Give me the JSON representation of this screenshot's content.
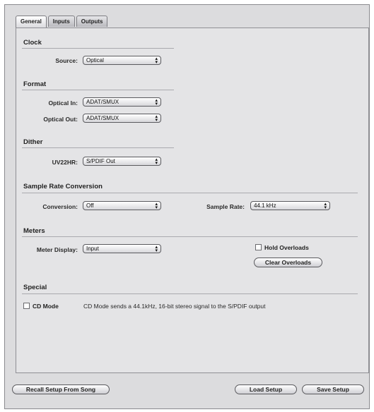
{
  "tabs": [
    {
      "label": "General"
    },
    {
      "label": "Inputs"
    },
    {
      "label": "Outputs"
    }
  ],
  "clock": {
    "heading": "Clock",
    "source": {
      "label": "Source:",
      "value": "Optical"
    }
  },
  "format": {
    "heading": "Format",
    "optical_in": {
      "label": "Optical In:",
      "value": "ADAT/SMUX"
    },
    "optical_out": {
      "label": "Optical Out:",
      "value": "ADAT/SMUX"
    }
  },
  "dither": {
    "heading": "Dither",
    "uv22hr": {
      "label": "UV22HR:",
      "value": "S/PDIF Out"
    }
  },
  "src": {
    "heading": "Sample Rate Conversion",
    "conversion": {
      "label": "Conversion:",
      "value": "Off"
    },
    "sample_rate": {
      "label": "Sample Rate:",
      "value": "44.1 kHz"
    }
  },
  "meters": {
    "heading": "Meters",
    "meter_display": {
      "label": "Meter Display:",
      "value": "Input"
    },
    "hold_overloads": "Hold Overloads",
    "clear_overloads": "Clear Overloads"
  },
  "special": {
    "heading": "Special",
    "cd_mode": "CD Mode",
    "cd_mode_desc": "CD Mode sends a 44.1kHz, 16-bit stereo signal to the S/PDIF output"
  },
  "footer": {
    "recall": "Recall Setup From Song",
    "load": "Load Setup",
    "save": "Save Setup"
  }
}
